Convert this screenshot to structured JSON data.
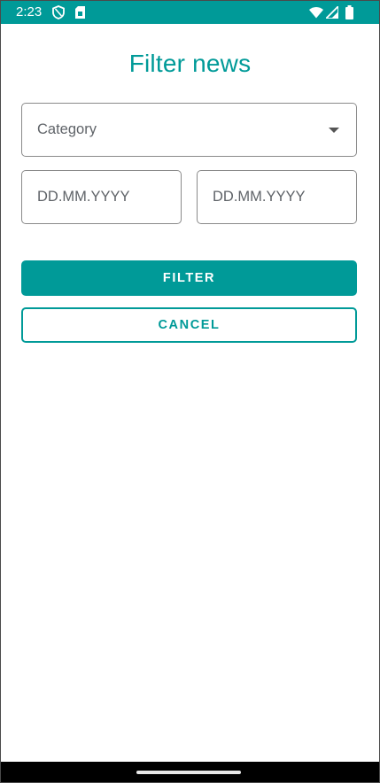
{
  "status_bar": {
    "time": "2:23",
    "background_color": "#009a98",
    "icons_left": [
      "shield-icon",
      "sim-card-icon"
    ],
    "icons_right": [
      "wifi-icon",
      "cellular-signal-icon",
      "battery-icon"
    ]
  },
  "dialog": {
    "title": "Filter news",
    "category": {
      "placeholder": "Category"
    },
    "date_from": {
      "placeholder": "DD.MM.YYYY"
    },
    "date_to": {
      "placeholder": "DD.MM.YYYY"
    },
    "filter_label": "FILTER",
    "cancel_label": "CANCEL"
  },
  "colors": {
    "accent": "#009a98",
    "field_border": "#8a8a8a",
    "placeholder_text": "#5f6368"
  }
}
